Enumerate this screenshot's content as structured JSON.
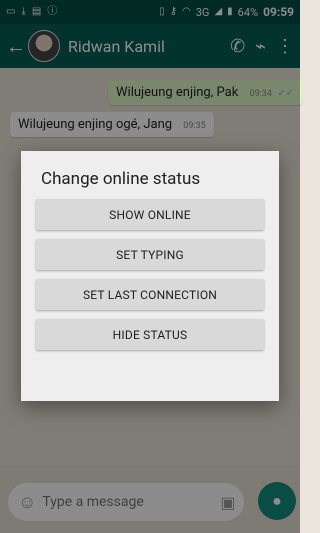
{
  "status_bar": {
    "battery": "64%",
    "network": "3G",
    "time": "09:59"
  },
  "header": {
    "back_icon": "arrow-left-icon",
    "contact_name": "Ridwan Kamil",
    "actions": [
      "phone-icon",
      "attach-icon",
      "more-icon"
    ]
  },
  "messages": [
    {
      "direction": "out",
      "text": "Wilujeung enjing, Pak",
      "time": "09:34",
      "ticks": "✓✓"
    },
    {
      "direction": "in",
      "text": "Wilujeung enjing ogé, Jang",
      "time": "09:35"
    }
  ],
  "dialog": {
    "title": "Change online status",
    "buttons": [
      "SHOW ONLINE",
      "SET TYPING",
      "SET LAST CONNECTION",
      "HIDE STATUS"
    ]
  },
  "composer": {
    "placeholder": "Type a message"
  },
  "colors": {
    "primary": "#075e54",
    "status_bar": "#054d44",
    "accent": "#128c7e",
    "outgoing_bubble": "#dcf8c6"
  }
}
